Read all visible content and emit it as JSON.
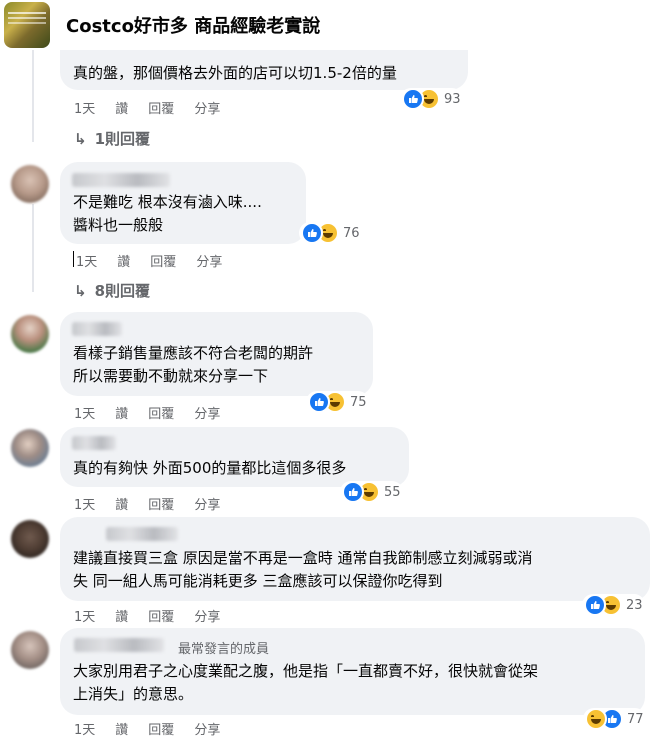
{
  "group": {
    "title": "Costco好市多 商品經驗老實說"
  },
  "comments": [
    {
      "lines": [
        "真的盤，那個價格去外面的店可以切1.5-2倍的量"
      ],
      "time": "1天",
      "reaction_count": "93",
      "reply_link": "1則回覆"
    },
    {
      "lines": [
        "不是難吃 根本沒有滷入味....",
        "醬料也一般般"
      ],
      "time": "1天",
      "reaction_count": "76",
      "reply_link": "8則回覆"
    },
    {
      "lines": [
        "看樣子銷售量應該不符合老闆的期許",
        "所以需要動不動就來分享一下"
      ],
      "time": "1天",
      "reaction_count": "75"
    },
    {
      "lines": [
        "真的有夠快 外面500的量都比這個多很多"
      ],
      "time": "1天",
      "reaction_count": "55"
    },
    {
      "lines": [
        "建議直接買三盒 原因是當不再是一盒時 通常自我節制感立刻減弱或消",
        "失 同一組人馬可能消耗更多 三盒應該可以保證你吃得到"
      ],
      "time": "1天",
      "reaction_count": "23"
    },
    {
      "badge": "最常發言的成員",
      "lines": [
        "大家別用君子之心度業配之腹，他是指「一直都賣不好，很快就會從架",
        "上消失」的意思。"
      ],
      "time": "1天",
      "reaction_count": "77"
    }
  ],
  "actions": {
    "read": "讚",
    "reply": "回覆",
    "share": "分享"
  },
  "icons": {
    "like": "like-icon",
    "haha": "haha-icon",
    "reply_arrow": "reply-arrow-icon"
  },
  "colors": {
    "bubble": "#f0f2f5",
    "secondary_text": "#65676b",
    "like_blue": "#1877f2",
    "haha_yellow": "#f7c133"
  }
}
